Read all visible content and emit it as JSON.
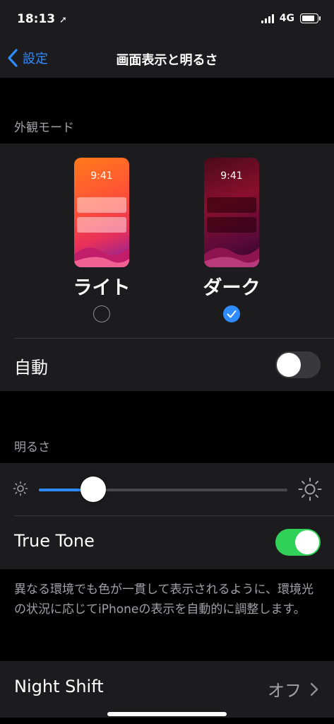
{
  "status": {
    "time": "18:13",
    "network": "4G",
    "battery_level": 0.85
  },
  "nav": {
    "back_label": "設定",
    "title": "画面表示と明るさ"
  },
  "appearance": {
    "section_title": "外観モード",
    "options": [
      {
        "label": "ライト",
        "preview_time": "9:41",
        "selected": false
      },
      {
        "label": "ダーク",
        "preview_time": "9:41",
        "selected": true
      }
    ],
    "auto": {
      "label": "自動",
      "on": false
    }
  },
  "brightness": {
    "section_title": "明るさ",
    "level": 0.22,
    "true_tone": {
      "label": "True Tone",
      "on": true
    },
    "footer": "異なる環境でも色が一貫して表示されるように、環境光の状況に応じてiPhoneの表示を自動的に調整します。"
  },
  "night_shift": {
    "label": "Night Shift",
    "value": "オフ"
  },
  "colors": {
    "accent": "#2f8cff",
    "toggle_on": "#30d158",
    "toggle_off": "#39393d"
  }
}
